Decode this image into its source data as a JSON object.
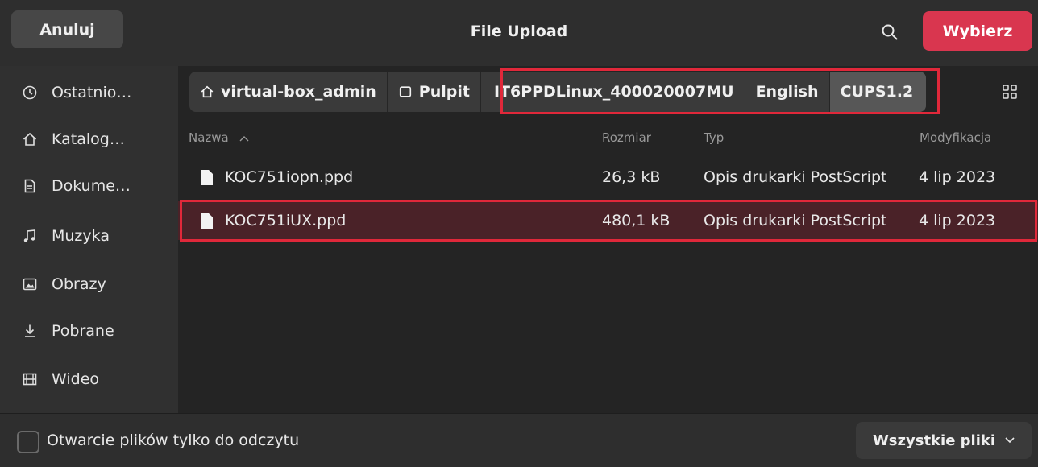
{
  "header": {
    "cancel_label": "Anuluj",
    "title": "File Upload",
    "search_icon": "search-icon",
    "select_label": "Wybierz"
  },
  "sidebar": {
    "items": [
      {
        "label": "Ostatnio…",
        "icon": "clock-icon"
      },
      {
        "label": "Katalog…",
        "icon": "home-icon"
      },
      {
        "label": "Dokume…",
        "icon": "document-icon"
      },
      {
        "label": "Muzyka",
        "icon": "music-icon"
      },
      {
        "label": "Obrazy",
        "icon": "image-icon"
      },
      {
        "label": "Pobrane",
        "icon": "download-icon"
      },
      {
        "label": "Wideo",
        "icon": "video-icon"
      }
    ]
  },
  "path": {
    "crumbs": [
      {
        "label": "virtual-box_admin",
        "icon": "home-icon"
      },
      {
        "label": "Pulpit",
        "icon": "desktop-icon"
      },
      {
        "label": "IT6PPDLinux_400020007MU"
      },
      {
        "label": "English"
      },
      {
        "label": "CUPS1.2",
        "active": true
      }
    ]
  },
  "columns": {
    "name": "Nazwa",
    "size": "Rozmiar",
    "type": "Typ",
    "modified": "Modyfikacja"
  },
  "files": [
    {
      "name": "KOC751iopn.ppd",
      "size": "26,3 kB",
      "type": "Opis drukarki PostScript",
      "modified": "4 lip 2023",
      "selected": false
    },
    {
      "name": "KOC751iUX.ppd",
      "size": "480,1 kB",
      "type": "Opis drukarki PostScript",
      "modified": "4 lip 2023",
      "selected": true
    }
  ],
  "footer": {
    "readonly_label": "Otwarcie plików tylko do odczytu",
    "filter_label": "Wszystkie pliki"
  },
  "colors": {
    "accent": "#d9364f",
    "annotation": "#e0283a",
    "selected_row": "#4a2228"
  }
}
